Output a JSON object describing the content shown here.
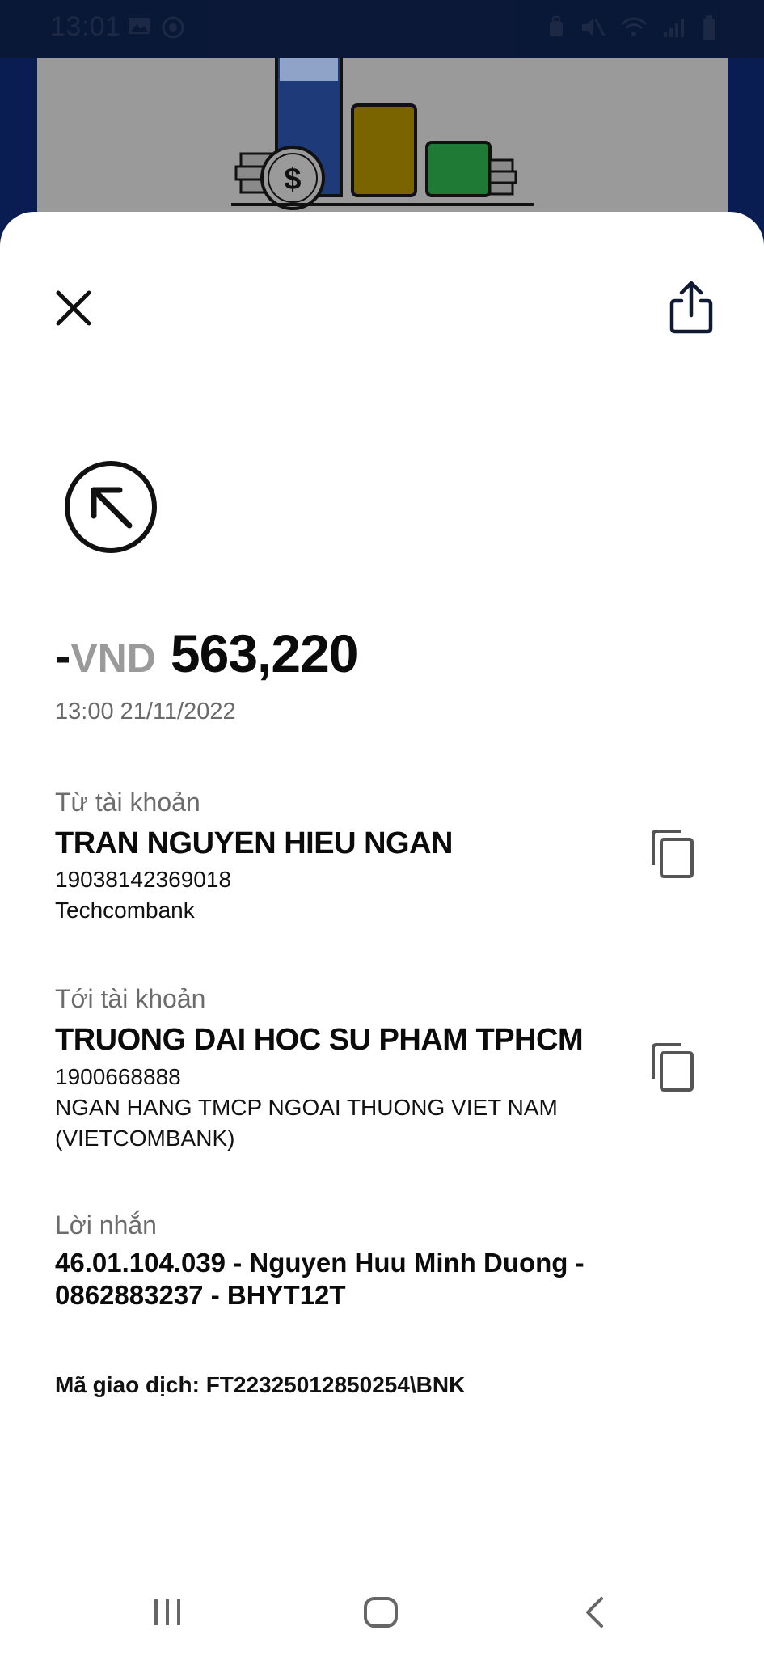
{
  "status_bar": {
    "time": "13:01",
    "left_icons": [
      "gallery-icon",
      "messenger-icon"
    ],
    "right_icons": [
      "alarm-icon",
      "mute-icon",
      "wifi-icon",
      "signal-icon",
      "battery-icon"
    ]
  },
  "banner": {
    "illustration": "bar-chart-coins-illustration",
    "bar_colors": [
      "#1e3a78",
      "#7a6400",
      "#1f7a36"
    ]
  },
  "header": {
    "close_icon": "close-icon",
    "share_icon": "share-icon"
  },
  "transaction": {
    "direction_icon": "arrow-up-left-circle-icon",
    "sign": "-",
    "currency": "VND",
    "amount": "563,220",
    "datetime": "13:00 21/11/2022"
  },
  "from_account": {
    "label": "Từ tài khoản",
    "name": "TRAN NGUYEN HIEU NGAN",
    "number": "19038142369018",
    "bank": "Techcombank"
  },
  "to_account": {
    "label": "Tới tài khoản",
    "name": "TRUONG DAI HOC SU PHAM TPHCM",
    "number": "1900668888",
    "bank_line1": "NGAN HANG TMCP NGOAI THUONG VIET NAM",
    "bank_line2": "(VIETCOMBANK)"
  },
  "message": {
    "label": "Lời nhắn",
    "text": "46.01.104.039 - Nguyen Huu Minh Duong - 0862883237 - BHYT12T"
  },
  "transaction_id": {
    "label": "Mã giao dịch:",
    "value": "FT22325012850254\\BNK"
  },
  "nav_bar": {
    "items": [
      "recent-apps-icon",
      "home-icon",
      "back-icon"
    ]
  },
  "colors": {
    "header_bg": "#0a1d52",
    "muted_text": "#6c6c6c",
    "currency_gray": "#9a9a9a"
  }
}
